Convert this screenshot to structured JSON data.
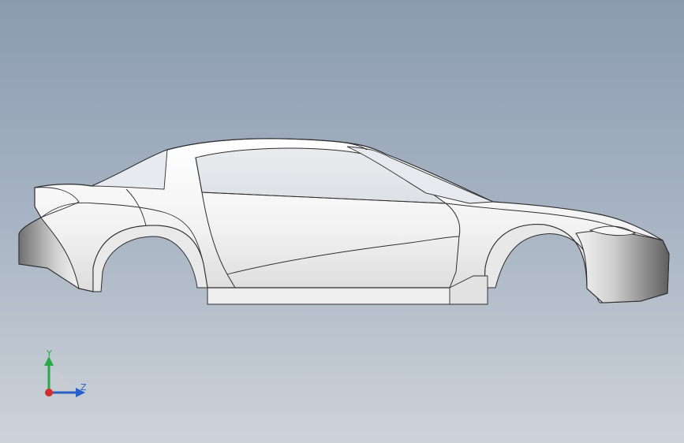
{
  "viewport": {
    "background_top": "#8a9bb0",
    "background_bottom": "#cdd3d9"
  },
  "model": {
    "name": "car-body",
    "surface_color": "#f3f3f3",
    "edge_color": "#2d2d2d"
  },
  "triad": {
    "y_label": "Y",
    "z_label": "Z",
    "y_color": "#2aa84a",
    "z_color": "#2a5fc9",
    "origin_color": "#d22c2c"
  }
}
